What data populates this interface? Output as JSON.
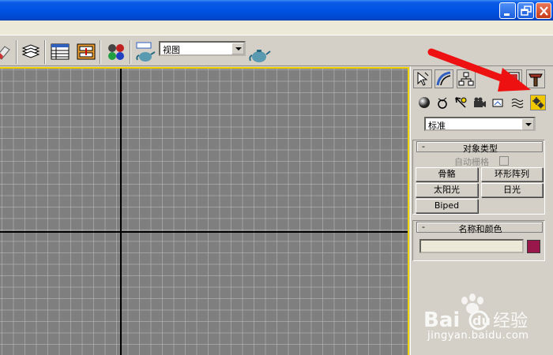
{
  "window": {
    "controls": [
      "minimize",
      "restore",
      "close"
    ]
  },
  "toolbar": {
    "view_dropdown": "视图",
    "icons": [
      "eraser-icon",
      "layers-icon",
      "table-icon",
      "track-view-icon",
      "material-spheres-icon",
      "render-teapot-icon",
      "quick-render-icon"
    ]
  },
  "viewport": {
    "border_color": "#f0d200",
    "background": "#7f7f7f"
  },
  "command_panel": {
    "tabs": [
      "create",
      "modify",
      "hierarchy",
      "motion",
      "display",
      "utilities"
    ],
    "subcategories": [
      "geometry",
      "shapes",
      "lights",
      "cameras",
      "helpers",
      "space-warps",
      "systems"
    ],
    "category_dropdown": "标准",
    "object_type": {
      "title": "对象类型",
      "collapse": "-",
      "autogrid_label": "自动栅格",
      "buttons": [
        "骨骼",
        "环形阵列",
        "太阳光",
        "日光",
        "Biped"
      ]
    },
    "name_color": {
      "title": "名称和颜色",
      "collapse": "-",
      "name_value": "",
      "color": "#99174a"
    }
  },
  "annotation": {
    "arrow_color": "#ee1111"
  },
  "watermark": {
    "logo_text": "Bai",
    "logo_text2": "经验",
    "url": "jingyan.baidu.com"
  }
}
